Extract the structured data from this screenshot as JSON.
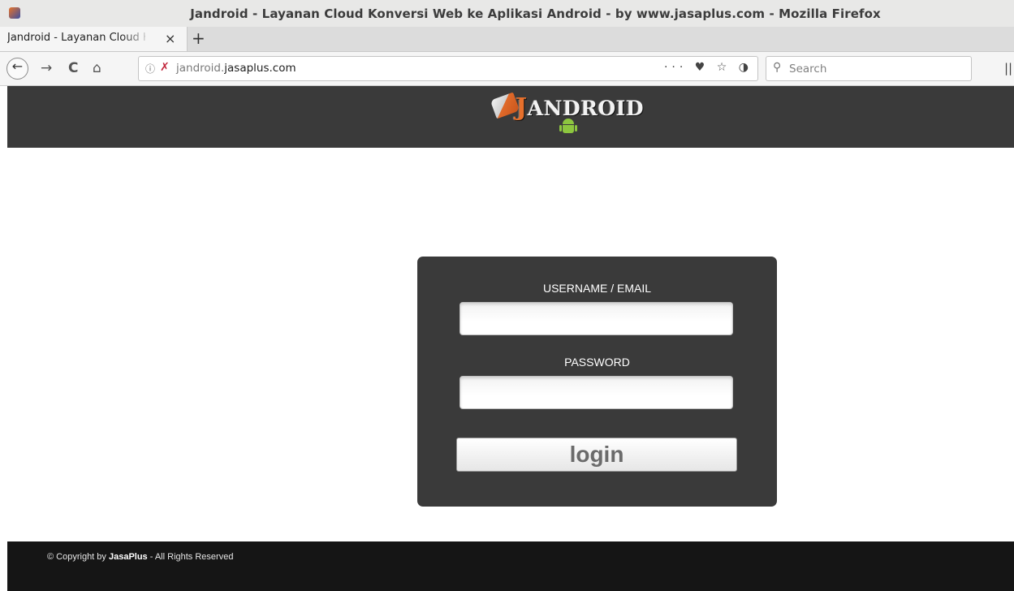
{
  "window": {
    "title": "Jandroid - Layanan Cloud Konversi Web ke Aplikasi Android - by www.jasaplus.com - Mozilla Firefox"
  },
  "tabs": [
    {
      "label": "Jandroid - Layanan Cloud Konversi Web ke Aplikasi Android",
      "close": "×"
    }
  ],
  "newtab_label": "+",
  "nav": {
    "back": "←",
    "forward": "→",
    "reload": "C",
    "home": "⌂",
    "url_prefix": "jandroid.",
    "url_domain": "jasaplus.com",
    "page_actions": "··· ♥ ☆ ◑",
    "info_icon": "ⓘ",
    "insecure_icon": "✗",
    "search_placeholder": "Search",
    "search_icon": "⚲",
    "library_icon": "|||\\"
  },
  "site": {
    "logo_j": "J",
    "logo_rest": "ANDROID",
    "login": {
      "username_label": "USERNAME / EMAIL",
      "username_value": "",
      "password_label": "PASSWORD",
      "password_value": "",
      "button_label": "login"
    },
    "footer": {
      "prefix": "© Copyright by ",
      "brand": "JasaPlus",
      "suffix": " - All Rights Reserved"
    }
  }
}
